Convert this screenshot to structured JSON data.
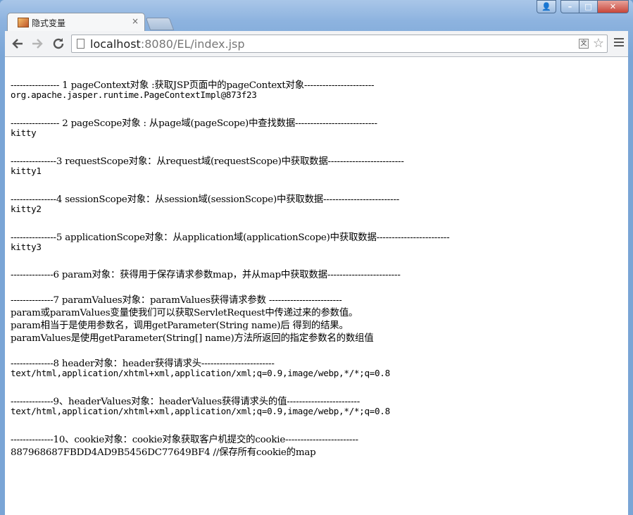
{
  "browser": {
    "tab_title": "隐式变量",
    "tab_close": "×",
    "url_host": "localhost",
    "url_rest": ":8080/EL/index.jsp",
    "window_controls": {
      "minimize": "–",
      "maximize": "□",
      "close": "✕"
    }
  },
  "content": {
    "lines": [
      "---------------- 1 pageContext对象 :获取JSP页面中的pageContext对象-----------------------",
      "org.apache.jasper.runtime.PageContextImpl@873f23",
      "---------------- 2 pageScope对象 : 从page域(pageScope)中查找数据---------------------------",
      "kitty",
      "---------------3 requestScope对象：从request域(requestScope)中获取数据-------------------------",
      "kitty1",
      "---------------4 sessionScope对象：从session域(sessionScope)中获取数据-------------------------",
      "kitty2",
      "---------------5 applicationScope对象：从application域(applicationScope)中获取数据------------------------",
      "kitty3",
      "--------------6 param对象：获得用于保存请求参数map，并从map中获取数据------------------------",
      "--------------7 paramValues对象：paramValues获得请求参数 ------------------------",
      "param或paramValues变量使我们可以获取ServletRequest中传递过来的参数值。",
      "param相当于是使用参数名，调用getParameter(String name)后 得到的结果。",
      "paramValues是使用getParameter(String[] name)方法所返回的指定参数名的数组值",
      "--------------8 header对象：header获得请求头------------------------",
      "text/html,application/xhtml+xml,application/xml;q=0.9,image/webp,*/*;q=0.8",
      "--------------9、headerValues对象：headerValues获得请求头的值------------------------",
      "text/html,application/xhtml+xml,application/xml;q=0.9,image/webp,*/*;q=0.8",
      "--------------10、cookie对象：cookie对象获取客户机提交的cookie------------------------",
      "887968687FBDD4AD9B5456DC77649BF4 //保存所有cookie的map"
    ]
  }
}
